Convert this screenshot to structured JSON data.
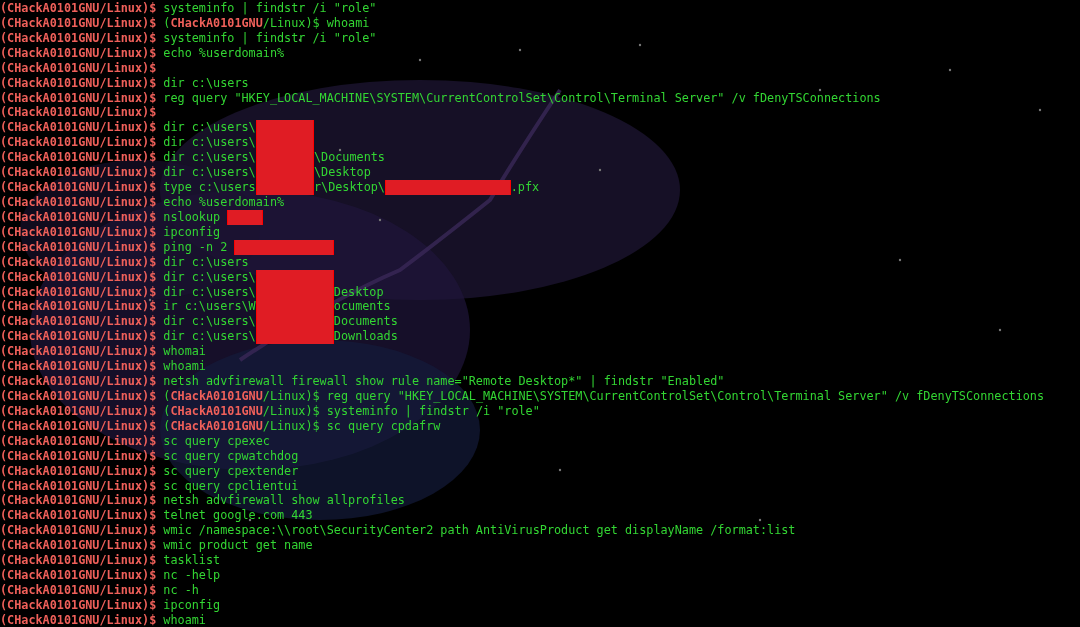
{
  "terminal": {
    "lines": [
      {
        "segments": [
          {
            "kind": "prompt",
            "text": "(CHackA0101GNU/Linux)$"
          },
          {
            "kind": "cmd",
            "text": "systeminfo | findstr /i \"role\""
          }
        ]
      },
      {
        "segments": [
          {
            "kind": "prompt",
            "text": "(CHackA0101GNU/Linux)$"
          },
          {
            "kind": "cmd",
            "text": "("
          },
          {
            "kind": "host",
            "text": "CHackA0101GNU"
          },
          {
            "kind": "cmd",
            "text": "/Linux)$ whoami"
          }
        ]
      },
      {
        "segments": [
          {
            "kind": "prompt",
            "text": "(CHackA0101GNU/Linux)$"
          },
          {
            "kind": "cmd",
            "text": "systeminfo | findstr /i \"role\""
          }
        ]
      },
      {
        "segments": [
          {
            "kind": "prompt",
            "text": "(CHackA0101GNU/Linux)$"
          },
          {
            "kind": "cmd",
            "text": "echo %userdomain%"
          }
        ]
      },
      {
        "segments": [
          {
            "kind": "prompt",
            "text": "(CHackA0101GNU/Linux)$"
          }
        ]
      },
      {
        "segments": [
          {
            "kind": "prompt",
            "text": "(CHackA0101GNU/Linux)$"
          },
          {
            "kind": "cmd",
            "text": "dir c:\\users"
          }
        ]
      },
      {
        "segments": [
          {
            "kind": "prompt",
            "text": "(CHackA0101GNU/Linux)$"
          },
          {
            "kind": "cmd",
            "text": "reg query \"HKEY_LOCAL_MACHINE\\SYSTEM\\CurrentControlSet\\Control\\Terminal Server\" /v fDenyTSConnections"
          }
        ]
      },
      {
        "segments": [
          {
            "kind": "prompt",
            "text": "(CHackA0101GNU/Linux)$"
          }
        ]
      },
      {
        "segments": [
          {
            "kind": "prompt",
            "text": "(CHackA0101GNU/Linux)$"
          },
          {
            "kind": "cmd",
            "text": "dir c:\\users\\"
          },
          {
            "kind": "redaction"
          }
        ]
      },
      {
        "segments": [
          {
            "kind": "prompt",
            "text": "(CHackA0101GNU/Linux)$"
          },
          {
            "kind": "cmd",
            "text": "dir c:\\users\\"
          },
          {
            "kind": "redaction"
          }
        ]
      },
      {
        "segments": [
          {
            "kind": "prompt",
            "text": "(CHackA0101GNU/Linux)$"
          },
          {
            "kind": "cmd",
            "text": "dir c:\\users\\"
          },
          {
            "kind": "redaction"
          },
          {
            "kind": "cmd",
            "text": "\\Documents"
          }
        ]
      },
      {
        "segments": [
          {
            "kind": "prompt",
            "text": "(CHackA0101GNU/Linux)$"
          },
          {
            "kind": "cmd",
            "text": "dir c:\\users\\"
          },
          {
            "kind": "redaction"
          },
          {
            "kind": "cmd",
            "text": "\\Desktop"
          }
        ]
      },
      {
        "segments": [
          {
            "kind": "prompt",
            "text": "(CHackA0101GNU/Linux)$"
          },
          {
            "kind": "cmd",
            "text": "type c:\\users"
          },
          {
            "kind": "redaction"
          },
          {
            "kind": "cmd",
            "text": "r\\Desktop\\"
          },
          {
            "kind": "redaction"
          },
          {
            "kind": "cmd",
            "text": ".pfx"
          }
        ]
      },
      {
        "segments": [
          {
            "kind": "prompt",
            "text": "(CHackA0101GNU/Linux)$"
          },
          {
            "kind": "cmd",
            "text": "echo %userdomain%"
          }
        ]
      },
      {
        "segments": [
          {
            "kind": "prompt",
            "text": "(CHackA0101GNU/Linux)$"
          },
          {
            "kind": "cmd",
            "text": "nslookup "
          },
          {
            "kind": "redaction"
          }
        ]
      },
      {
        "segments": [
          {
            "kind": "prompt",
            "text": "(CHackA0101GNU/Linux)$"
          },
          {
            "kind": "cmd",
            "text": "ipconfig"
          }
        ]
      },
      {
        "segments": [
          {
            "kind": "prompt",
            "text": "(CHackA0101GNU/Linux)$"
          },
          {
            "kind": "cmd",
            "text": "ping -n 2 "
          },
          {
            "kind": "redaction"
          }
        ]
      },
      {
        "segments": [
          {
            "kind": "prompt",
            "text": "(CHackA0101GNU/Linux)$"
          },
          {
            "kind": "cmd",
            "text": "dir c:\\users"
          }
        ]
      },
      {
        "segments": [
          {
            "kind": "prompt",
            "text": "(CHackA0101GNU/Linux)$"
          },
          {
            "kind": "cmd",
            "text": "dir c:\\users\\"
          },
          {
            "kind": "redaction"
          }
        ]
      },
      {
        "segments": [
          {
            "kind": "prompt",
            "text": "(CHackA0101GNU/Linux)$"
          },
          {
            "kind": "cmd",
            "text": "dir c:\\users\\"
          },
          {
            "kind": "redaction"
          },
          {
            "kind": "cmd",
            "text": "Desktop"
          }
        ]
      },
      {
        "segments": [
          {
            "kind": "prompt",
            "text": "(CHackA0101GNU/Linux)$"
          },
          {
            "kind": "cmd",
            "text": "ir c:\\users\\W"
          },
          {
            "kind": "redaction"
          },
          {
            "kind": "cmd",
            "text": "ocuments"
          }
        ]
      },
      {
        "segments": [
          {
            "kind": "prompt",
            "text": "(CHackA0101GNU/Linux)$"
          },
          {
            "kind": "cmd",
            "text": "dir c:\\users\\"
          },
          {
            "kind": "redaction"
          },
          {
            "kind": "cmd",
            "text": "Documents"
          }
        ]
      },
      {
        "segments": [
          {
            "kind": "prompt",
            "text": "(CHackA0101GNU/Linux)$"
          },
          {
            "kind": "cmd",
            "text": "dir c:\\users\\"
          },
          {
            "kind": "redaction"
          },
          {
            "kind": "cmd",
            "text": "Downloads"
          }
        ]
      },
      {
        "segments": [
          {
            "kind": "prompt",
            "text": "(CHackA0101GNU/Linux)$"
          },
          {
            "kind": "cmd",
            "text": "whomai"
          }
        ]
      },
      {
        "segments": [
          {
            "kind": "prompt",
            "text": "(CHackA0101GNU/Linux)$"
          },
          {
            "kind": "cmd",
            "text": "whoami"
          }
        ]
      },
      {
        "segments": [
          {
            "kind": "prompt",
            "text": "(CHackA0101GNU/Linux)$"
          },
          {
            "kind": "cmd",
            "text": "netsh advfirewall firewall show rule name=\"Remote Desktop*\" | findstr \"Enabled\""
          }
        ]
      },
      {
        "segments": [
          {
            "kind": "prompt",
            "text": "(CHackA0101GNU/Linux)$"
          },
          {
            "kind": "cmd",
            "text": "("
          },
          {
            "kind": "host",
            "text": "CHackA0101GNU"
          },
          {
            "kind": "cmd",
            "text": "/Linux)$ reg query \"HKEY_LOCAL_MACHINE\\SYSTEM\\CurrentControlSet\\Control\\Terminal Server\" /v fDenyTSConnections"
          }
        ]
      },
      {
        "segments": [
          {
            "kind": "prompt",
            "text": "(CHackA0101GNU/Linux)$"
          },
          {
            "kind": "cmd",
            "text": "("
          },
          {
            "kind": "host",
            "text": "CHackA0101GNU"
          },
          {
            "kind": "cmd",
            "text": "/Linux)$ systeminfo | findstr /i \"role\""
          }
        ]
      },
      {
        "segments": [
          {
            "kind": "prompt",
            "text": "(CHackA0101GNU/Linux)$"
          },
          {
            "kind": "cmd",
            "text": "("
          },
          {
            "kind": "host",
            "text": "CHackA0101GNU"
          },
          {
            "kind": "cmd",
            "text": "/Linux)$ sc query cpdafrw"
          }
        ]
      },
      {
        "segments": [
          {
            "kind": "prompt",
            "text": "(CHackA0101GNU/Linux)$"
          },
          {
            "kind": "cmd",
            "text": "sc query cpexec"
          }
        ]
      },
      {
        "segments": [
          {
            "kind": "prompt",
            "text": "(CHackA0101GNU/Linux)$"
          },
          {
            "kind": "cmd",
            "text": "sc query cpwatchdog"
          }
        ]
      },
      {
        "segments": [
          {
            "kind": "prompt",
            "text": "(CHackA0101GNU/Linux)$"
          },
          {
            "kind": "cmd",
            "text": "sc query cpextender"
          }
        ]
      },
      {
        "segments": [
          {
            "kind": "prompt",
            "text": "(CHackA0101GNU/Linux)$"
          },
          {
            "kind": "cmd",
            "text": "sc query cpclientui"
          }
        ]
      },
      {
        "segments": [
          {
            "kind": "prompt",
            "text": "(CHackA0101GNU/Linux)$"
          },
          {
            "kind": "cmd",
            "text": "netsh advfirewall show allprofiles"
          }
        ]
      },
      {
        "segments": [
          {
            "kind": "prompt",
            "text": "(CHackA0101GNU/Linux)$"
          },
          {
            "kind": "cmd",
            "text": "telnet google.com 443"
          }
        ]
      },
      {
        "segments": [
          {
            "kind": "prompt",
            "text": "(CHackA0101GNU/Linux)$"
          },
          {
            "kind": "cmd",
            "text": "wmic /namespace:\\\\root\\SecurityCenter2 path AntiVirusProduct get displayName /format:list"
          }
        ]
      },
      {
        "segments": [
          {
            "kind": "prompt",
            "text": "(CHackA0101GNU/Linux)$"
          },
          {
            "kind": "cmd",
            "text": "wmic product get name"
          }
        ]
      },
      {
        "segments": [
          {
            "kind": "prompt",
            "text": "(CHackA0101GNU/Linux)$"
          },
          {
            "kind": "cmd",
            "text": "tasklist"
          }
        ]
      },
      {
        "segments": [
          {
            "kind": "prompt",
            "text": "(CHackA0101GNU/Linux)$"
          },
          {
            "kind": "cmd",
            "text": "nc -help"
          }
        ]
      },
      {
        "segments": [
          {
            "kind": "prompt",
            "text": "(CHackA0101GNU/Linux)$"
          },
          {
            "kind": "cmd",
            "text": "nc -h"
          }
        ]
      },
      {
        "segments": [
          {
            "kind": "prompt",
            "text": "(CHackA0101GNU/Linux)$"
          },
          {
            "kind": "cmd",
            "text": "ipconfig"
          }
        ]
      },
      {
        "segments": [
          {
            "kind": "prompt",
            "text": "(CHackA0101GNU/Linux)$"
          },
          {
            "kind": "cmd",
            "text": "whoami"
          }
        ]
      }
    ]
  }
}
